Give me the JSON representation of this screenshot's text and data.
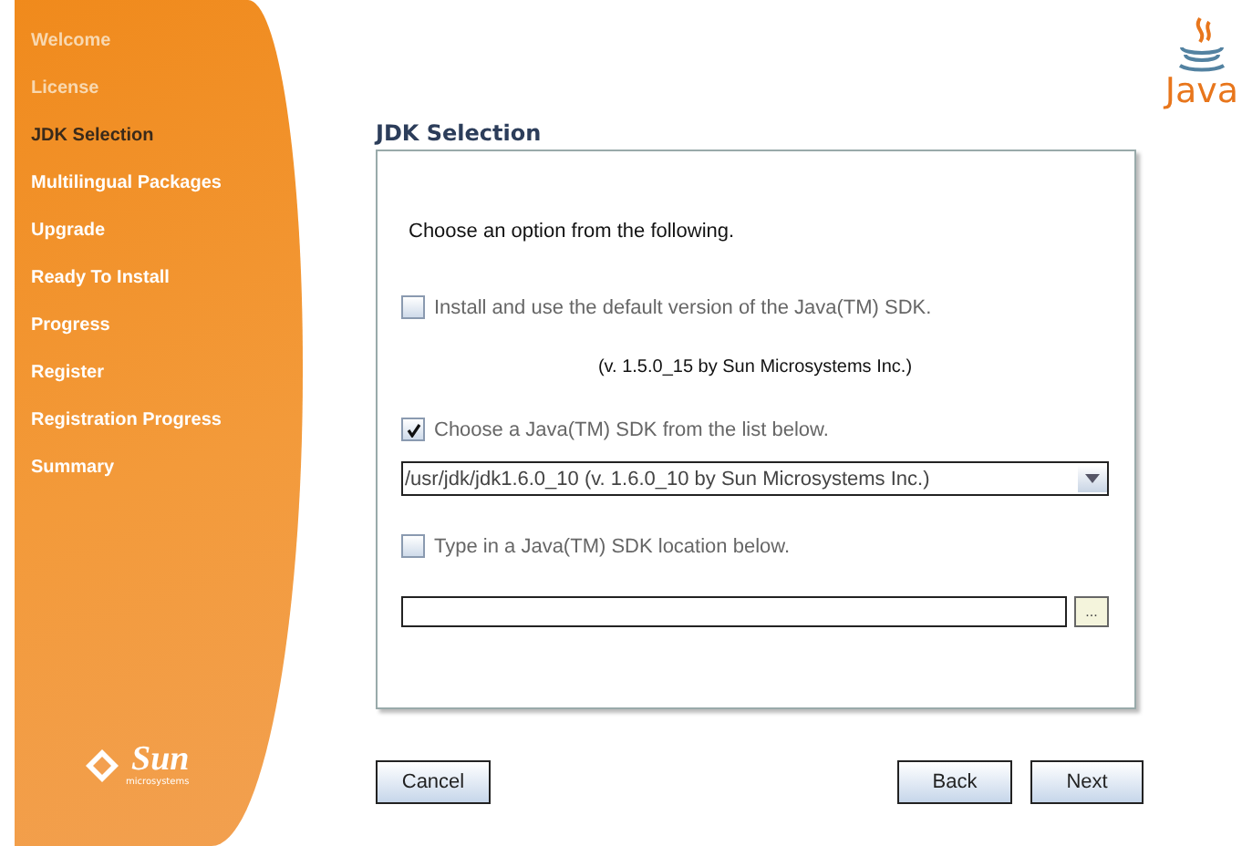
{
  "sidebar": {
    "steps": [
      {
        "label": "Welcome",
        "completed": true,
        "selected": false
      },
      {
        "label": "License",
        "completed": true,
        "selected": false
      },
      {
        "label": "JDK Selection",
        "completed": false,
        "selected": true
      },
      {
        "label": "Multilingual Packages",
        "completed": false,
        "selected": false
      },
      {
        "label": "Upgrade",
        "completed": false,
        "selected": false
      },
      {
        "label": "Ready To Install",
        "completed": false,
        "selected": false
      },
      {
        "label": "Progress",
        "completed": false,
        "selected": false
      },
      {
        "label": "Register",
        "completed": false,
        "selected": false
      },
      {
        "label": "Registration Progress",
        "completed": false,
        "selected": false
      },
      {
        "label": "Summary",
        "completed": false,
        "selected": false
      }
    ],
    "logo": {
      "name": "Sun",
      "tagline": "microsystems"
    }
  },
  "java_logo": "Java",
  "page_title": "JDK Selection",
  "intro": "Choose an option from the following.",
  "options": [
    {
      "kind": "checkbox",
      "label": "Install and use the default version of the Java(TM) SDK.",
      "checked": false
    },
    {
      "kind": "note",
      "label": "(v. 1.5.0_15 by Sun Microsystems Inc.)"
    },
    {
      "kind": "checkbox",
      "label": "Choose a Java(TM) SDK from the list below.",
      "checked": true
    },
    {
      "kind": "select",
      "value": "/usr/jdk/jdk1.6.0_10 (v. 1.6.0_10 by Sun Microsystems Inc.)"
    },
    {
      "kind": "checkbox",
      "label": "Type in a Java(TM) SDK location below.",
      "checked": false
    },
    {
      "kind": "path",
      "browse": "..."
    }
  ],
  "buttons": {
    "left": [
      "Cancel"
    ],
    "right": [
      "Back",
      "Next"
    ]
  }
}
